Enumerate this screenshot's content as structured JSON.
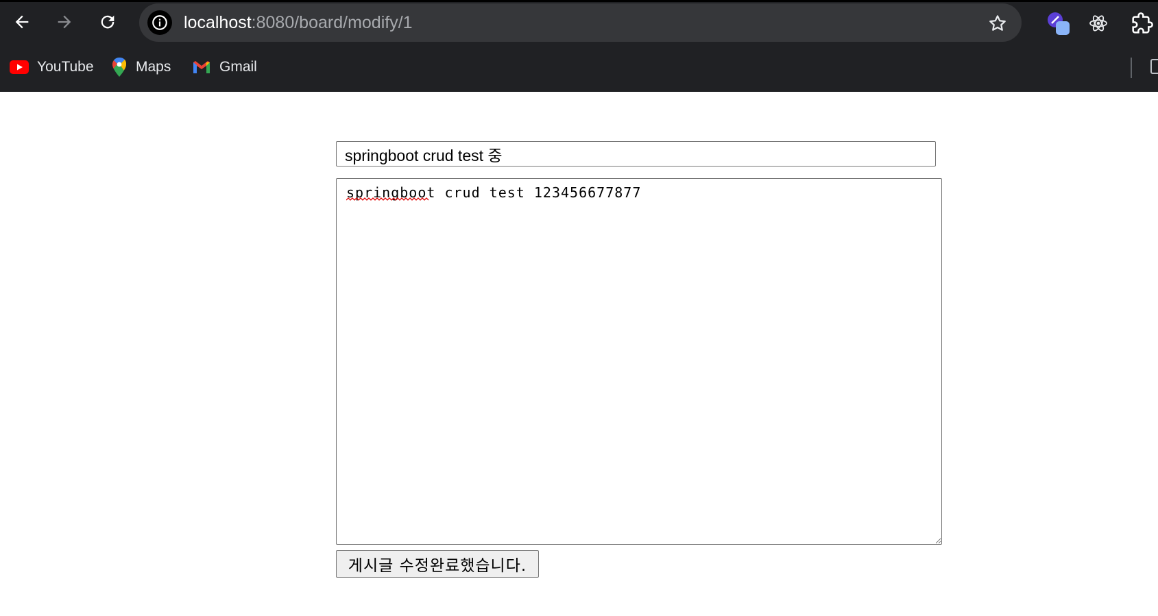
{
  "browser": {
    "url_host": "localhost",
    "url_path": ":8080/board/modify/1",
    "bookmarks": [
      {
        "label": "YouTube",
        "icon": "youtube-icon"
      },
      {
        "label": "Maps",
        "icon": "maps-icon"
      },
      {
        "label": "Gmail",
        "icon": "gmail-icon"
      }
    ],
    "extensions": [
      "dev-extension-icon",
      "react-devtools-icon",
      "extensions-puzzle-icon"
    ]
  },
  "form": {
    "title_value": "springboot crud test 중",
    "content_value": "springboot crud test 123456677877",
    "submit_label": "게시글 수정완료했습니다."
  },
  "colors": {
    "chrome_bg": "#202124",
    "omnibox_bg": "#36373a",
    "youtube_red": "#ff0000",
    "spellcheck_red": "#e00000"
  }
}
